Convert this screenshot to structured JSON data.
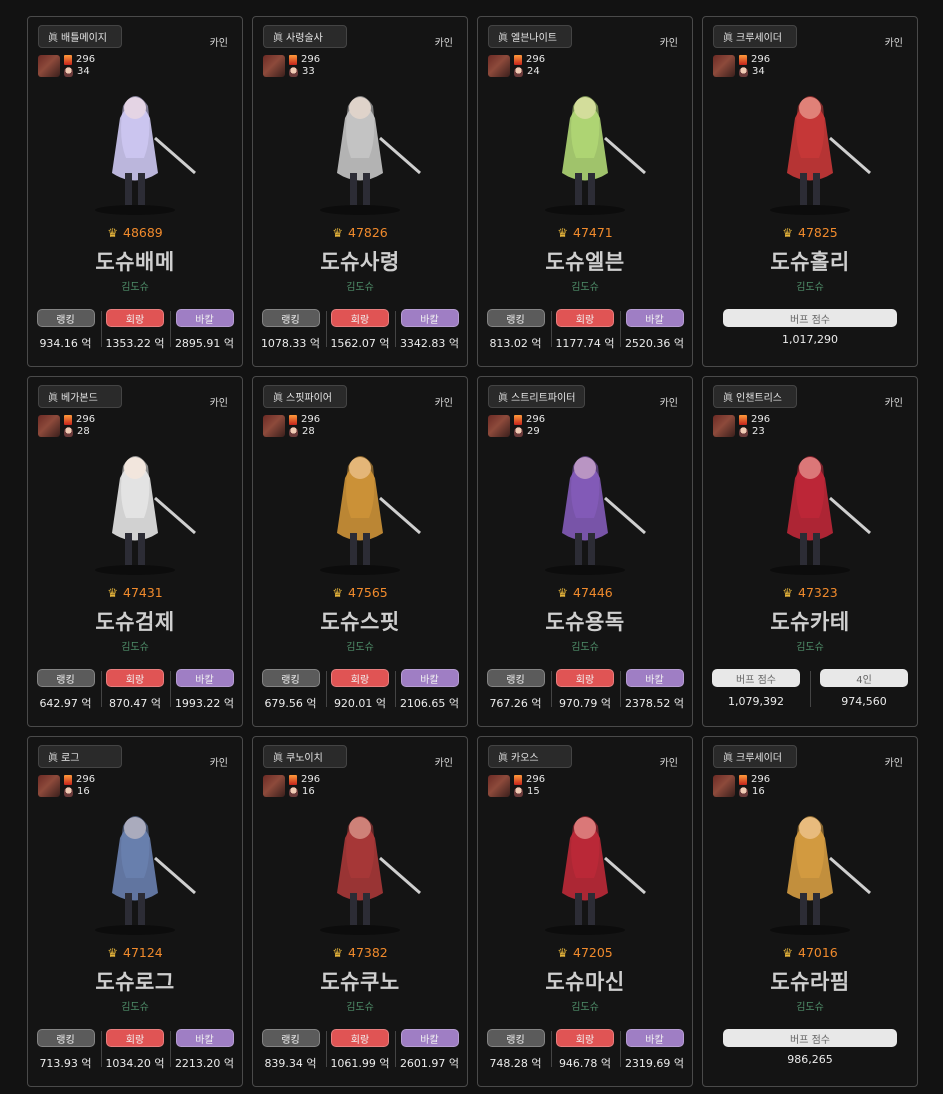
{
  "cards": [
    {
      "job": "배틀메이지",
      "server": "카인",
      "fame": "296",
      "level": "34",
      "power": "48689",
      "name": "도슈배메",
      "guild": "김도슈",
      "type": "dealer",
      "rank": "934.16 억",
      "hoe": "1353.22 억",
      "bakal": "2895.91 억",
      "accent": "#d8d2ff"
    },
    {
      "job": "사령술사",
      "server": "카인",
      "fame": "296",
      "level": "33",
      "power": "47826",
      "name": "도슈사령",
      "guild": "김도슈",
      "type": "dealer",
      "rank": "1078.33 억",
      "hoe": "1562.07 억",
      "bakal": "3342.83 억",
      "accent": "#cfcfcf"
    },
    {
      "job": "엘븐나이트",
      "server": "카인",
      "fame": "296",
      "level": "24",
      "power": "47471",
      "name": "도슈엘븐",
      "guild": "김도슈",
      "type": "dealer",
      "rank": "813.02 억",
      "hoe": "1177.74 억",
      "bakal": "2520.36 억",
      "accent": "#b9e27a"
    },
    {
      "job": "크루세이더",
      "server": "카인",
      "fame": "296",
      "level": "34",
      "power": "47825",
      "name": "도슈홀리",
      "guild": "김도슈",
      "type": "buffer",
      "buff_label": "버프 점수",
      "buff": "1,017,290",
      "accent": "#d23a3a"
    },
    {
      "job": "베가본드",
      "server": "카인",
      "fame": "296",
      "level": "28",
      "power": "47431",
      "name": "도슈검제",
      "guild": "김도슈",
      "type": "dealer",
      "rank": "642.97 억",
      "hoe": "870.47 억",
      "bakal": "1993.22 억",
      "accent": "#f2f2f2"
    },
    {
      "job": "스핏파이어",
      "server": "카인",
      "fame": "296",
      "level": "28",
      "power": "47565",
      "name": "도슈스핏",
      "guild": "김도슈",
      "type": "dealer",
      "rank": "679.56 억",
      "hoe": "920.01 억",
      "bakal": "2106.65 억",
      "accent": "#d89a3a"
    },
    {
      "job": "스트리트파이터",
      "server": "카인",
      "fame": "296",
      "level": "29",
      "power": "47446",
      "name": "도슈용독",
      "guild": "김도슈",
      "type": "dealer",
      "rank": "767.26 억",
      "hoe": "970.79 억",
      "bakal": "2378.52 억",
      "accent": "#8a5fc2"
    },
    {
      "job": "인챈트리스",
      "server": "카인",
      "fame": "296",
      "level": "23",
      "power": "47323",
      "name": "도슈카테",
      "guild": "김도슈",
      "type": "buffer2",
      "buff_label": "버프 점수",
      "buff": "1,079,392",
      "party_label": "4인",
      "party": "974,560",
      "accent": "#c8283a"
    },
    {
      "job": "로그",
      "server": "카인",
      "fame": "296",
      "level": "16",
      "power": "47124",
      "name": "도슈로그",
      "guild": "김도슈",
      "type": "dealer",
      "rank": "713.93 억",
      "hoe": "1034.20 억",
      "bakal": "2213.20 억",
      "accent": "#6f86b8"
    },
    {
      "job": "쿠노이치",
      "server": "카인",
      "fame": "296",
      "level": "16",
      "power": "47382",
      "name": "도슈쿠노",
      "guild": "김도슈",
      "type": "dealer",
      "rank": "839.34 억",
      "hoe": "1061.99 억",
      "bakal": "2601.97 억",
      "accent": "#b03a3a"
    },
    {
      "job": "카오스",
      "server": "카인",
      "fame": "296",
      "level": "15",
      "power": "47205",
      "name": "도슈마신",
      "guild": "김도슈",
      "type": "dealer",
      "rank": "748.28 억",
      "hoe": "946.78 억",
      "bakal": "2319.69 억",
      "accent": "#c72a3a"
    },
    {
      "job": "크루세이더",
      "server": "카인",
      "fame": "296",
      "level": "16",
      "power": "47016",
      "name": "도슈라핌",
      "guild": "김도슈",
      "type": "buffer",
      "buff_label": "버프 점수",
      "buff": "986,265",
      "accent": "#e0a444"
    }
  ],
  "labels": {
    "jin": "眞",
    "rank": "랭킹",
    "hoe": "회랑",
    "bakal": "바칼",
    "crown": "♛"
  },
  "colors": {
    "rank": "#5b5b5b",
    "hoe": "#e05454",
    "bakal": "#9f7ec4",
    "power": "#f08a2c",
    "guild": "#4f8f6a"
  }
}
